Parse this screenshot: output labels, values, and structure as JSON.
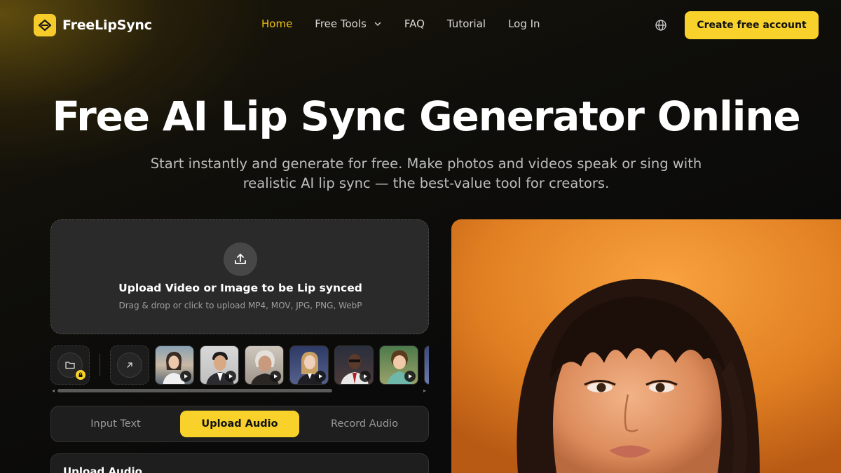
{
  "nav": {
    "logo_text": "FreeLipSync",
    "links": [
      "Home",
      "Free Tools",
      "FAQ",
      "Tutorial",
      "Log In"
    ],
    "active_link": "Home",
    "cta_label": "Create free account"
  },
  "hero": {
    "title": "Free AI Lip Sync Generator Online",
    "subtitle_line1": "Start instantly and generate for free. Make photos and videos speak or sing with",
    "subtitle_line2": "realistic AI lip sync — the best-value tool for creators."
  },
  "upload": {
    "title": "Upload Video or Image to be Lip synced",
    "hint": "Drag & drop or click to upload MP4, MOV, JPG, PNG, WebP"
  },
  "samples": {
    "count": 7
  },
  "audio_tabs": [
    "Input Text",
    "Upload Audio",
    "Record Audio"
  ],
  "active_audio_tab": "Upload Audio",
  "audio_panel": {
    "title": "Upload Audio"
  },
  "colors": {
    "accent": "#f8d22a",
    "nav_active": "#f5c518",
    "background": "#0a0a0a"
  }
}
